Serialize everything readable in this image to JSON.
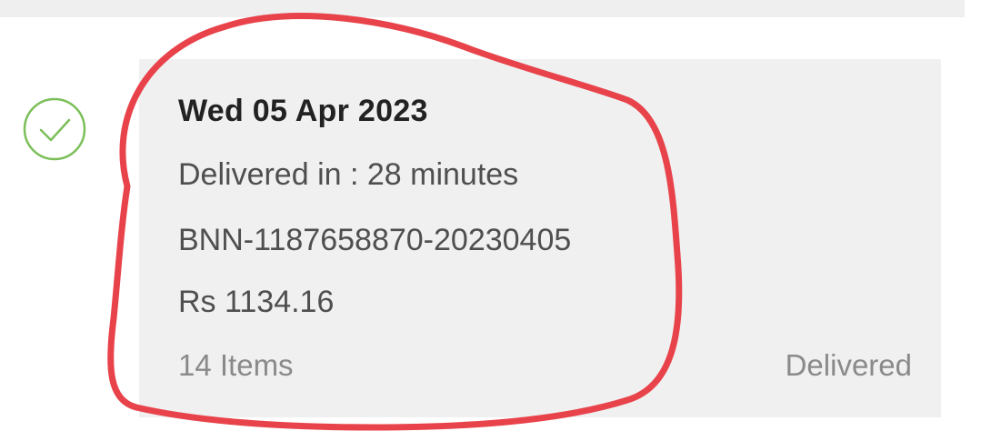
{
  "order": {
    "date": "Wed 05 Apr 2023",
    "delivery_time": "Delivered in : 28 minutes",
    "order_id": "BNN-1187658870-20230405",
    "amount": "Rs 1134.16",
    "items_count": "14 Items",
    "status": "Delivered"
  },
  "icons": {
    "status": "check-circle-icon"
  },
  "colors": {
    "check_green": "#7cbf5a",
    "annotation_red": "#e8434a",
    "card_background": "#f0f0f0"
  }
}
